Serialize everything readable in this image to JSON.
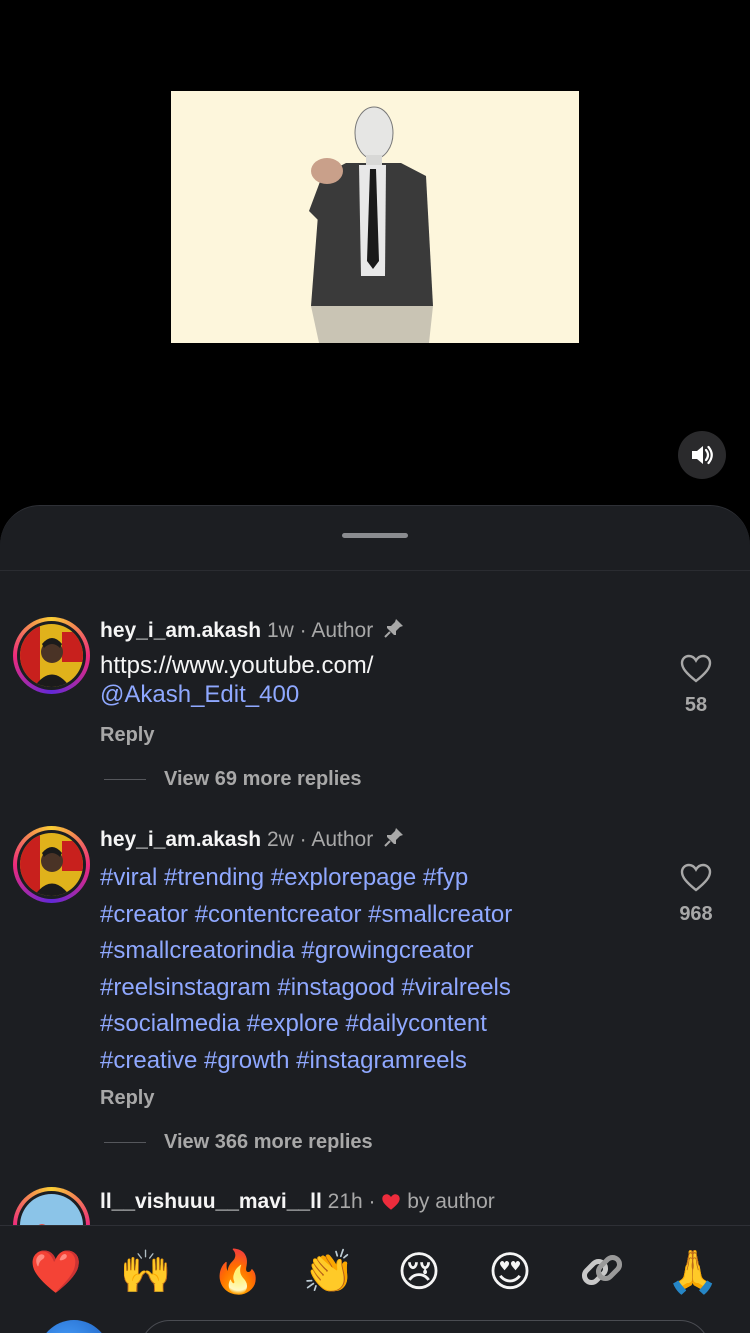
{
  "comments": [
    {
      "username": "hey_i_am.akash",
      "time": "1w",
      "separator": "·",
      "role": "Author",
      "body_line1": "https://www.youtube.com/",
      "body_line2": "@Akash_Edit_400",
      "reply_label": "Reply",
      "view_more": "View 69 more replies",
      "likes": "58"
    },
    {
      "username": "hey_i_am.akash",
      "time": "2w",
      "separator": "·",
      "role": "Author",
      "hashtag_lines": [
        "#viral #trending #explorepage #fyp",
        "#creator #contentcreator #smallcreator",
        "#smallcreatorindia #growingcreator",
        "#reelsinstagram #instagood #viralreels",
        "#socialmedia #explore #dailycontent",
        "#creative #growth #instagramreels"
      ],
      "reply_label": "Reply",
      "view_more": "View 366 more replies",
      "likes": "968"
    },
    {
      "username": "ll__vishuuu__mavi__ll",
      "time": "21h",
      "separator": "·",
      "liked_by": "by author"
    }
  ],
  "quick_reactions": [
    "❤️",
    "🙌",
    "🔥",
    "👏",
    "😢",
    "😍",
    "link-icon",
    "🙏"
  ],
  "colors": {
    "sheet_bg": "#1c1e22",
    "hashtag": "#8fa8ff",
    "meta_gray": "#a8a8a8",
    "heart_red": "#ed2c3c"
  }
}
